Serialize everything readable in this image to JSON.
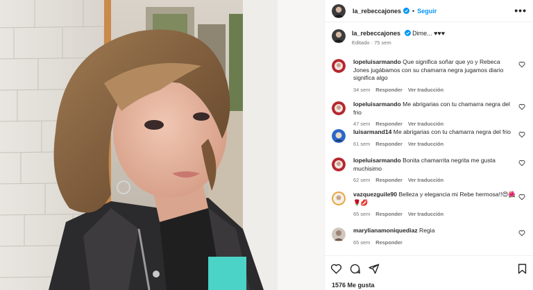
{
  "post": {
    "username": "la_rebeccajones",
    "follow_label": "Seguir",
    "separator": "•",
    "more_label": "•••",
    "caption_text": "Dime... ♥♥♥",
    "caption_meta": "Editado · 75 sem"
  },
  "comments": [
    {
      "user": "lopeluisarmando",
      "text": "Que significa soñar que yo y Rebeca Jones jugábamos con su chamarra negra jugamos diario significa algo",
      "time": "34 sem",
      "reply": "Responder",
      "translate": "Ver traducción"
    },
    {
      "user": "lopeluisarmando",
      "text": "Me abrigarias con tu chamarra negra del frio",
      "time": "47 sem",
      "reply": "Responder",
      "translate": "Ver traducción"
    },
    {
      "user": "luisarmand14",
      "text": "Me abrigarias con tu chamarra negra del frio",
      "time": "61 sem",
      "reply": "Responder",
      "translate": "Ver traducción"
    },
    {
      "user": "lopeluisarmando",
      "text": "Bonita chamarrita negrita me gusta muchisimo",
      "time": "62 sem",
      "reply": "Responder",
      "translate": "Ver traducción"
    },
    {
      "user": "vazquezguile90",
      "text": "Belleza y elegancia mi Rebe hermosa!!😍🌺🌹💋",
      "time": "65 sem",
      "reply": "Responder",
      "translate": "Ver traducción"
    },
    {
      "user": "marylianamoniquediaz",
      "text": "Regia",
      "time": "65 sem",
      "reply": "Responder",
      "translate": ""
    }
  ],
  "footer": {
    "likes": "1576 Me gusta"
  },
  "icons": {
    "like": "heart-icon",
    "comment": "comment-icon",
    "share": "share-icon",
    "save": "bookmark-icon",
    "verified": "verified-badge-icon",
    "more": "more-options-icon"
  },
  "colors": {
    "link": "#0095f6",
    "verified": "#0095f6",
    "muted": "#737373",
    "text": "#262626"
  }
}
